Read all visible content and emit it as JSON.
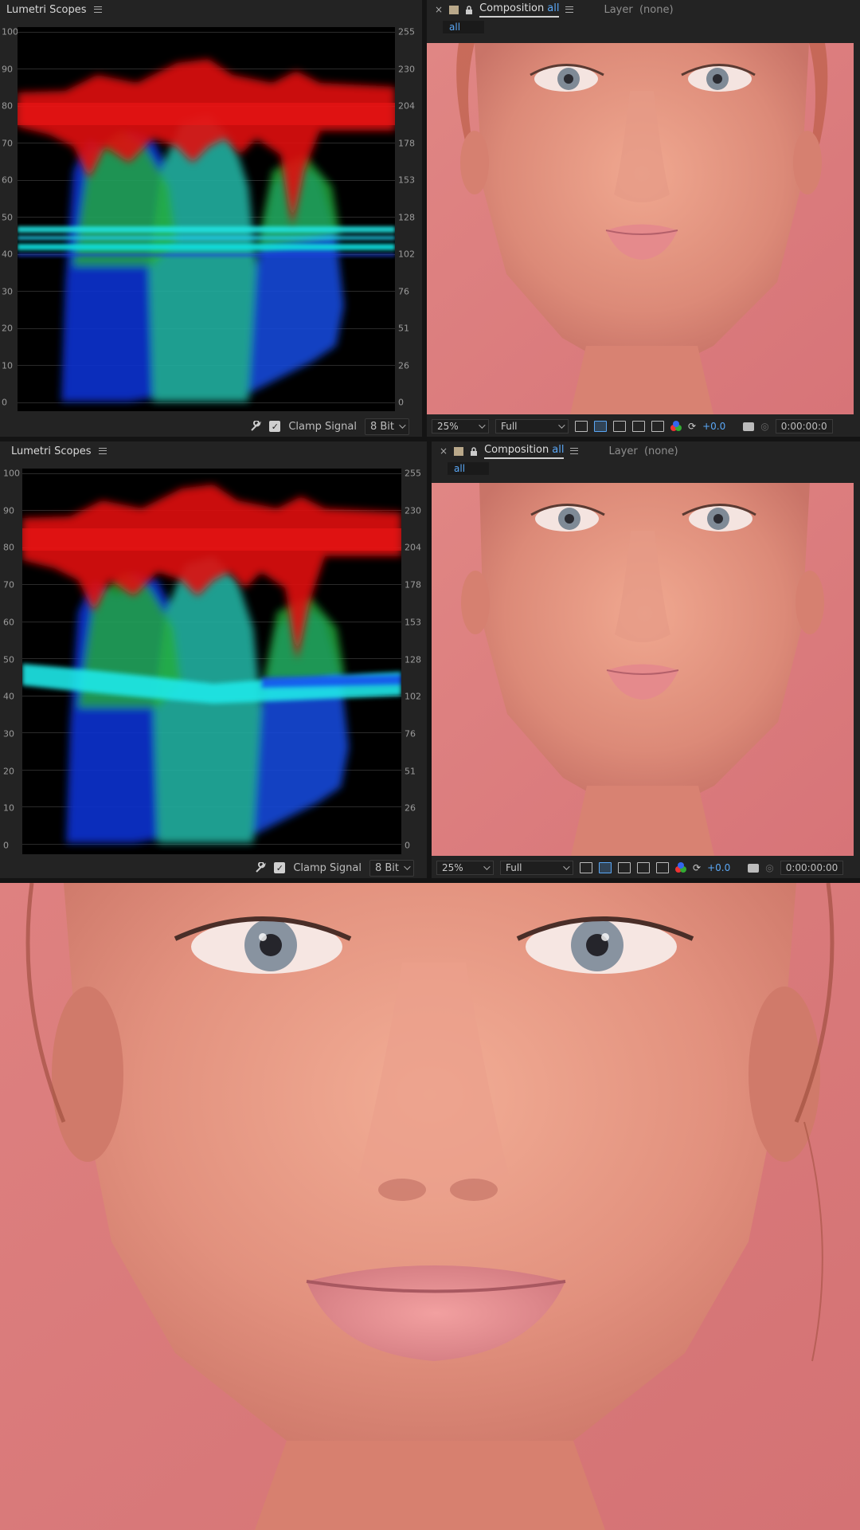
{
  "panels": [
    {
      "scope": {
        "title": "Lumetri Scopes",
        "left_ticks": [
          "100",
          "90",
          "80",
          "70",
          "60",
          "50",
          "40",
          "30",
          "20",
          "10",
          "0"
        ],
        "right_ticks": [
          "255",
          "230",
          "204",
          "178",
          "153",
          "128",
          "102",
          "76",
          "51",
          "26",
          "0"
        ],
        "clamp_label": "Clamp Signal",
        "clamp_checked": "✓",
        "bit_depth": "8 Bit"
      },
      "comp": {
        "close": "×",
        "tab_label": "Composition",
        "tab_name": "all",
        "layer_label": "Layer",
        "layer_value": "(none)",
        "subtab": "all",
        "zoom": "25%",
        "resolution": "Full",
        "exposure": "+0.0",
        "timecode": "0:00:00:0"
      }
    },
    {
      "scope": {
        "title": "Lumetri Scopes",
        "left_ticks": [
          "100",
          "90",
          "80",
          "70",
          "60",
          "50",
          "40",
          "30",
          "20",
          "10",
          "0"
        ],
        "right_ticks": [
          "255",
          "230",
          "204",
          "178",
          "153",
          "128",
          "102",
          "76",
          "51",
          "26",
          "0"
        ],
        "clamp_label": "Clamp Signal",
        "clamp_checked": "✓",
        "bit_depth": "8 Bit"
      },
      "comp": {
        "close": "×",
        "tab_label": "Composition",
        "tab_name": "all",
        "layer_label": "Layer",
        "layer_value": "(none)",
        "subtab": "all",
        "zoom": "25%",
        "resolution": "Full",
        "exposure": "+0.0",
        "timecode": "0:00:00:00"
      }
    }
  ],
  "colors": {
    "accent": "#5aa7f5",
    "panel_bg": "#232323",
    "background_pink": "#d9777a",
    "waveform_red": "#e01010",
    "waveform_green": "#22c040",
    "waveform_blue": "#1030e0",
    "waveform_cyan": "#20e0e0"
  },
  "icons": [
    "menu-icon",
    "wrench-icon",
    "checkbox-icon",
    "chevron-down-icon",
    "close-icon",
    "lock-icon",
    "region-of-interest-icon",
    "transparency-grid-icon",
    "mask-path-icon",
    "guides-icon",
    "channel-rgb-icon",
    "reset-exposure-icon",
    "snapshot-camera-icon"
  ]
}
